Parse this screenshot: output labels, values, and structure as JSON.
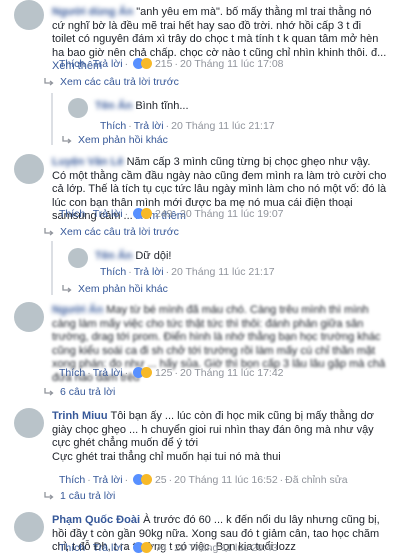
{
  "comments": [
    {
      "author": "",
      "text": "\"anh yêu em mà\". bố mấy thằng ml trai thằng nó cứ nghĩ bờ là đều mẽ trai hết hay sao đồ trời. nhớ hồi cấp 3 t đi toilet có nguyên đám xì trây do chọc t mà tính t k quan tâm mở hèn ha bao giờ nên chả chấp. chọc cờ nào t cũng chỉ nhìn khinh thôi. đ...",
      "see_more": "Xem thêm",
      "like": "Thích",
      "reply": "Trả lời",
      "reaction_count": "215",
      "time": "20 Tháng 11 lúc 17:08"
    },
    {
      "author": "",
      "text": "Bình tĩnh...",
      "like": "Thích",
      "reply": "Trả lời",
      "time": "20 Tháng 11 lúc 21:17"
    },
    {
      "author": "Luyện Văn Lê",
      "text": "Năm cấp 3 mình cũng từng bị chọc ghẹo như vậy. Có một thằng cầm đầu ngày nào cũng đem mình ra làm trò cười cho cả lớp. Thế là tích tụ cục tức lâu ngày mình làm cho nó một vố: đó là lúc con bạn thân mình mới được ba mẹ nó mua cái điện thoại samsung cảm ...",
      "see_more": "Xem thêm",
      "like": "Thích",
      "reply": "Trả lời",
      "reaction_count": "249",
      "time": "20 Tháng 11 lúc 19:07"
    },
    {
      "author": "",
      "text": "Dữ dội!",
      "like": "Thích",
      "reply": "Trả lời",
      "time": "20 Tháng 11 lúc 21:17"
    },
    {
      "author": "",
      "text": "May từ bé mình đã máu chó. Càng trêu mình thì mình càng làm mấy việc cho tức thật tức thì thôi: đánh phản giữa sân trường, drag tới prom. Điển hình là nhớ thằng bạn học trường khác cũng kiểu soái ca đi sh chở tới trường rồi làm mấy cú chỉ thần mặt xong phán: đo như ... hấy sủa. Giờ thì bọn cấp 3 lâu lâu gặp mà chả đứa nào dám trêu",
      "like": "Thích",
      "reply": "Trả lời",
      "reaction_count": "125",
      "time": "20 Tháng 11 lúc 17:42"
    },
    {
      "author": "Trinh Miuu",
      "text": "Tôi bạn ấy ... lúc còn đi học mik cũng bị mấy thằng dơ giày chọc ghẹo ... h chuyển gioi rui nhìn thay đán ông mà như vậy cực ghét chẳng muốn để ý tới\nCực ghét trai thẳng chỉ muốn hại tui nó mà thui",
      "like": "Thích",
      "reply": "Trả lời",
      "reaction_count": "25",
      "time": "20 Tháng 11 lúc 16:52",
      "edited": "Đã chỉnh sửa"
    },
    {
      "author": "Phạm Quốc Đoài",
      "text": "À trước đó 60 ... k đến nổi du lây nhưng cũng bị, hồi đầy t còn gần 90kg nữa. Xong sau đó t giảm cân, tao học chăm chỉ, t đỗ Đh, t ra trường t có việc. Bọn kia tuổi lozz",
      "like": "Thích",
      "reply": "Trả lời",
      "reaction_count": "74",
      "time": "20 Tháng 11 lúc 20:43"
    }
  ],
  "reply_links": {
    "prev_replies_1": "Xem các câu trả lời trước",
    "more_replies_1": "Xem phản hồi khác",
    "prev_replies_2": "Xem các câu trả lời trước",
    "more_replies_2": "Xem phản hồi khác",
    "six_replies": "6 câu trả lời",
    "one_reply": "1 câu trả lời"
  },
  "colors": {
    "link": "#365899",
    "meta": "#90949c",
    "like_blue": "#5890ff",
    "haha_yellow": "#f7b928"
  }
}
